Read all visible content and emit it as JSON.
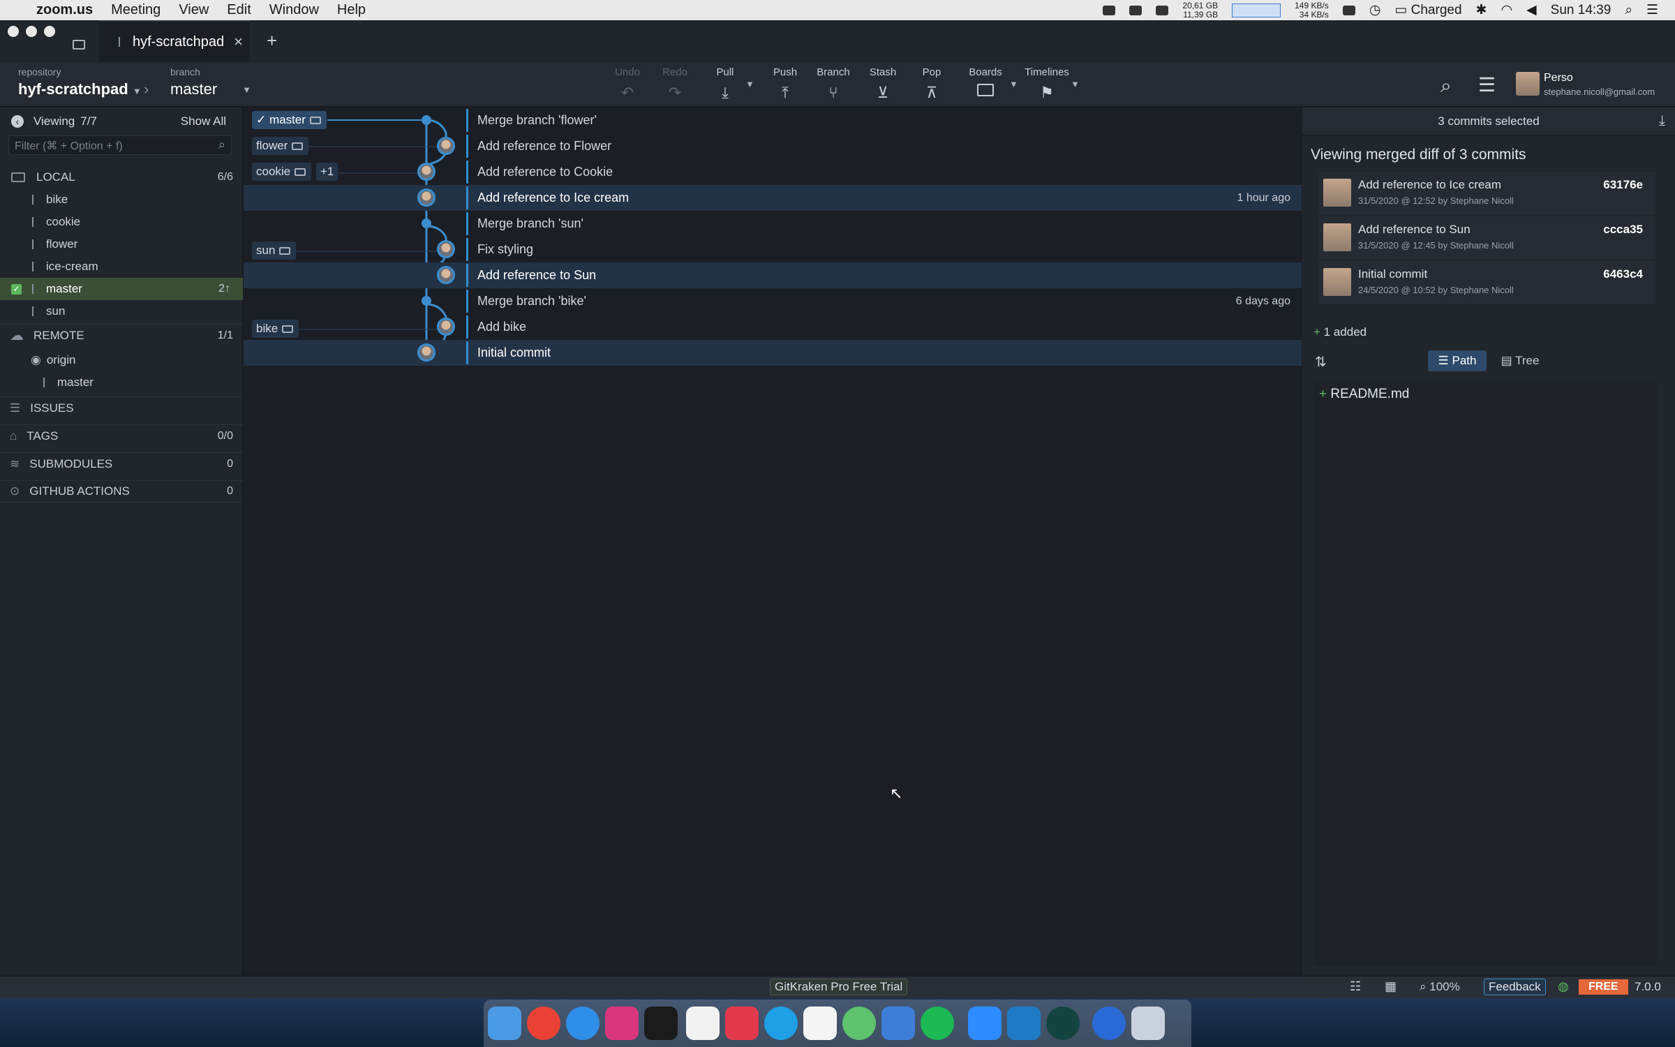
{
  "menubar": {
    "app": "zoom.us",
    "items": [
      "Meeting",
      "View",
      "Edit",
      "Window",
      "Help"
    ],
    "disk_u": "20,61 GB",
    "disk_f": "11,39 GB",
    "net_up": "149 KB/s",
    "net_down": "34 KB/s",
    "battery": "Charged",
    "clock": "Sun 14:39"
  },
  "tab": {
    "title": "hyf-scratchpad"
  },
  "toolbar": {
    "repo_label": "repository",
    "repo_name": "hyf-scratchpad",
    "branch_label": "branch",
    "branch_name": "master",
    "undo": "Undo",
    "redo": "Redo",
    "pull": "Pull",
    "push": "Push",
    "branch": "Branch",
    "stash": "Stash",
    "pop": "Pop",
    "boards": "Boards",
    "timelines": "Timelines",
    "profile_name": "Perso",
    "profile_email": "stephane.nicoll@gmail.com"
  },
  "sidebar": {
    "viewing": "Viewing",
    "viewing_count": "7/7",
    "show_all": "Show All",
    "filter_placeholder": "Filter (⌘ + Option + f)",
    "local": "LOCAL",
    "local_count": "6/6",
    "local_items": [
      "bike",
      "cookie",
      "flower",
      "ice-cream",
      "master",
      "sun"
    ],
    "master_ahead": "2↑",
    "remote": "REMOTE",
    "remote_count": "1/1",
    "origin": "origin",
    "origin_master": "master",
    "issues": "ISSUES",
    "tags": "TAGS",
    "tags_count": "0/0",
    "submodules": "SUBMODULES",
    "submodules_count": "0",
    "actions": "GITHUB ACTIONS",
    "actions_count": "0"
  },
  "graph": {
    "refs": {
      "master": "master",
      "flower": "flower",
      "cookie": "cookie",
      "cookie_extra": "+1",
      "icecream": "ice-cream",
      "sun": "sun",
      "bike": "bike"
    },
    "commits": [
      "Merge branch 'flower'",
      "Add reference to Flower",
      "Add reference to Cookie",
      "Add reference to Ice cream",
      "Merge branch 'sun'",
      "Fix styling",
      "Add reference to Sun",
      "Merge branch 'bike'",
      "Add bike",
      "Initial commit"
    ],
    "time1": "1 hour ago",
    "time2": "6 days ago"
  },
  "panel": {
    "header": "3 commits selected",
    "title": "Viewing merged diff of 3 commits",
    "cards": [
      {
        "title": "Add reference to Ice cream",
        "sub": "31/5/2020 @ 12:52 by Stephane Nicoll",
        "hash": "63176e"
      },
      {
        "title": "Add reference to Sun",
        "sub": "31/5/2020 @ 12:45 by Stephane Nicoll",
        "hash": "ccca35"
      },
      {
        "title": "Initial commit",
        "sub": "24/5/2020 @ 10:52 by Stephane Nicoll",
        "hash": "6463c4"
      }
    ],
    "added": "1 added",
    "path": "Path",
    "tree": "Tree",
    "file": "README.md"
  },
  "status": {
    "trial": "GitKraken Pro Free Trial",
    "zoom": "100%",
    "feedback": "Feedback",
    "free": "FREE",
    "version": "7.0.0"
  },
  "colors": {
    "accent": "#3b8ed0",
    "selected_row": "#233347",
    "free": "#e5673a",
    "green": "#5cb85c"
  }
}
